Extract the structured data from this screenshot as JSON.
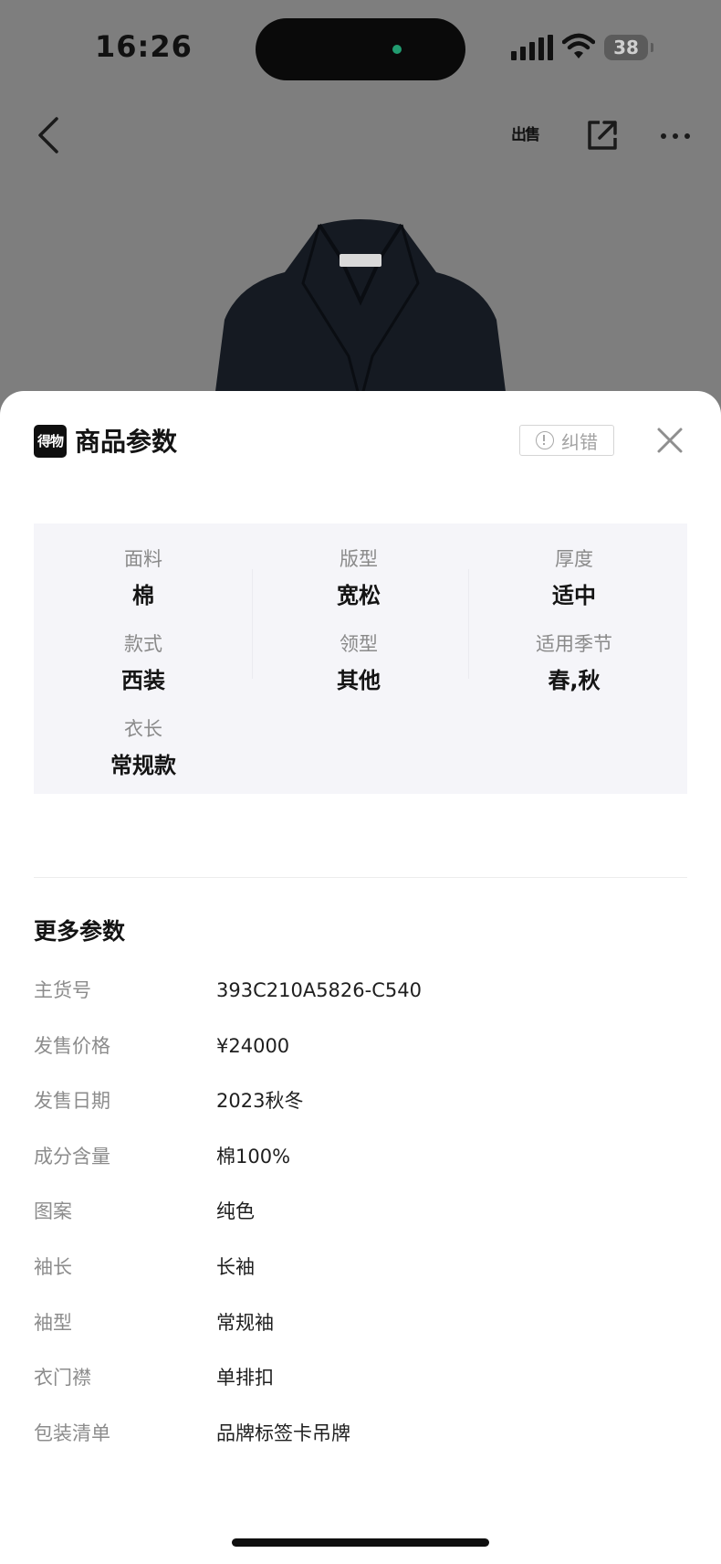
{
  "status_bar": {
    "time": "16:26",
    "battery": "38"
  },
  "nav": {
    "sell_label": "出售"
  },
  "sheet": {
    "logo_text": "得物",
    "title": "商品参数",
    "correction_label": "纠错"
  },
  "key_params": [
    {
      "label": "面料",
      "value": "棉"
    },
    {
      "label": "版型",
      "value": "宽松"
    },
    {
      "label": "厚度",
      "value": "适中"
    },
    {
      "label": "款式",
      "value": "西装"
    },
    {
      "label": "领型",
      "value": "其他"
    },
    {
      "label": "适用季节",
      "value": "春,秋"
    },
    {
      "label": "衣长",
      "value": "常规款"
    }
  ],
  "more_params": {
    "title": "更多参数",
    "rows": [
      {
        "key": "主货号",
        "value": "393C210A5826-C540"
      },
      {
        "key": "发售价格",
        "value": "¥24000"
      },
      {
        "key": "发售日期",
        "value": "2023秋冬"
      },
      {
        "key": "成分含量",
        "value": "棉100%"
      },
      {
        "key": "图案",
        "value": "纯色"
      },
      {
        "key": "袖长",
        "value": "长袖"
      },
      {
        "key": "袖型",
        "value": "常规袖"
      },
      {
        "key": "衣门襟",
        "value": "单排扣"
      },
      {
        "key": "包装清单",
        "value": "品牌标签卡吊牌"
      }
    ]
  }
}
